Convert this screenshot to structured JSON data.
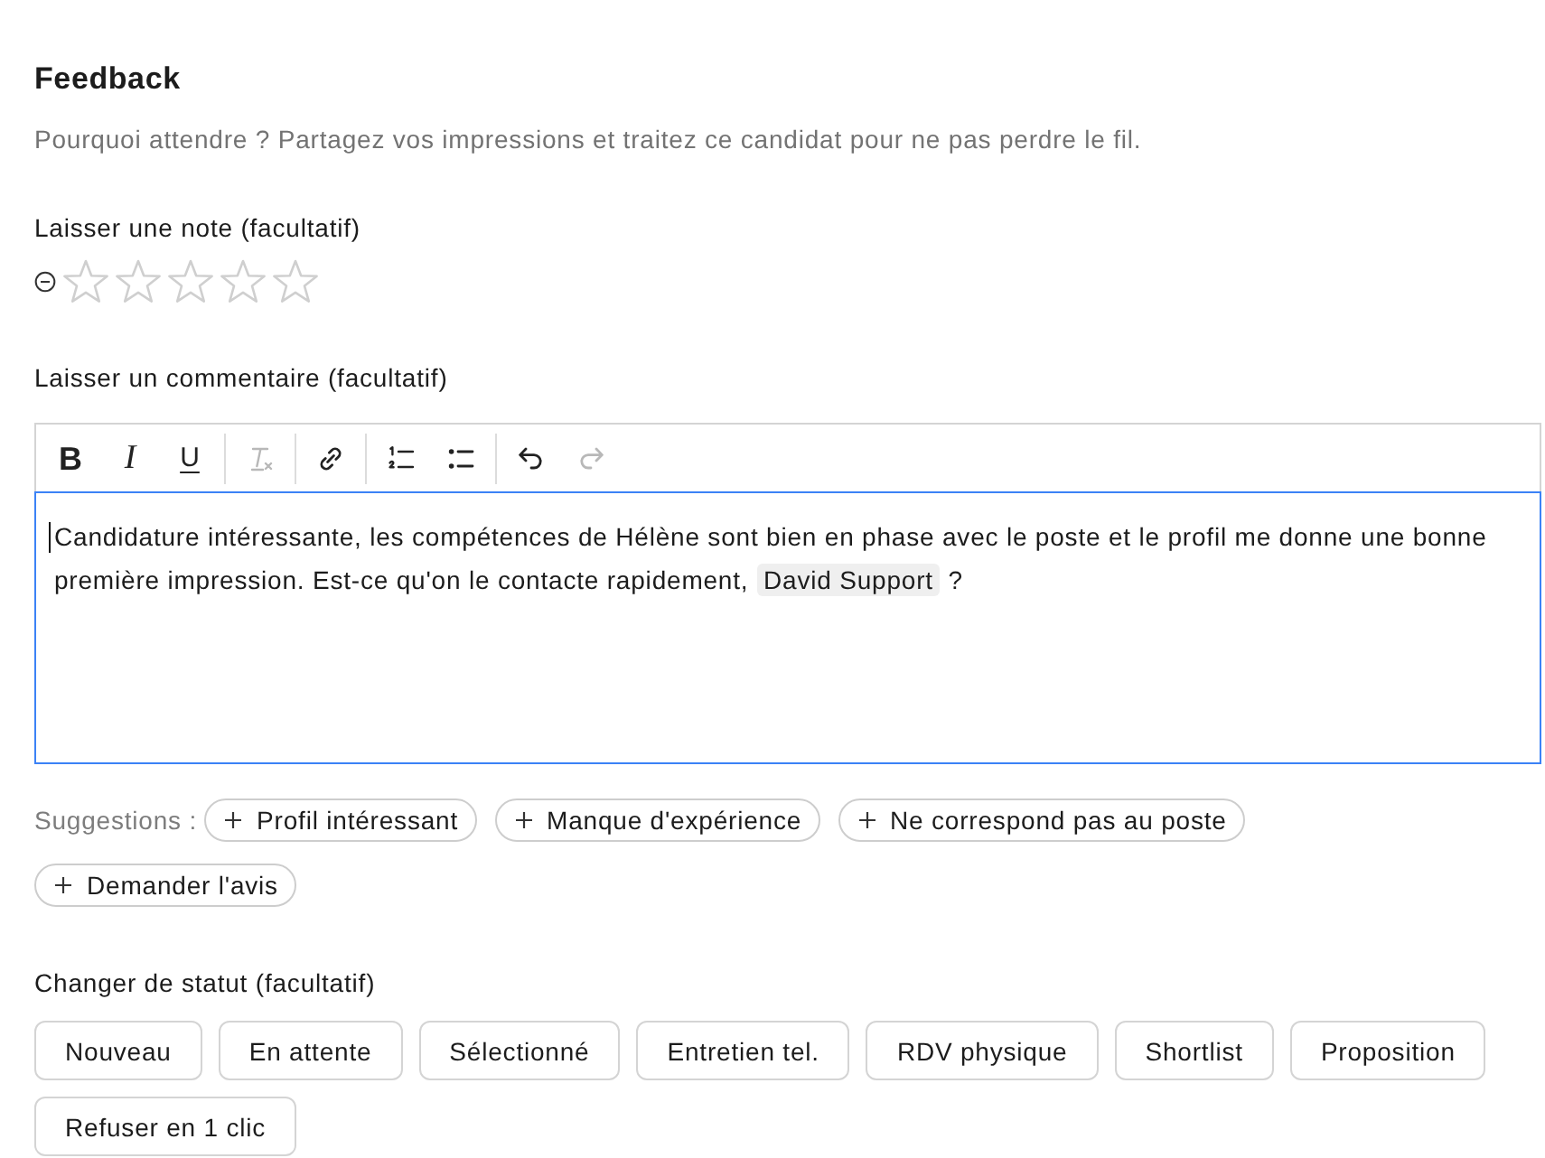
{
  "section": {
    "title": "Feedback",
    "subtitle": "Pourquoi attendre ? Partagez vos impressions et traitez ce candidat pour ne pas perdre le fil."
  },
  "rating": {
    "label": "Laisser une note (facultatif)",
    "stars": 0
  },
  "comment": {
    "label": "Laisser un commentaire (facultatif)",
    "toolbar": [
      {
        "items": [
          {
            "kind": "bold",
            "text": "B",
            "disabled": false
          },
          {
            "kind": "italic",
            "text": "I",
            "disabled": false
          },
          {
            "kind": "underline",
            "text": "U",
            "disabled": false
          }
        ]
      },
      {
        "items": [
          {
            "kind": "clear_format",
            "disabled": true
          }
        ]
      },
      {
        "items": [
          {
            "kind": "link",
            "disabled": false
          }
        ]
      },
      {
        "items": [
          {
            "kind": "ordered_list",
            "disabled": false
          },
          {
            "kind": "bullet_list",
            "disabled": false
          }
        ]
      },
      {
        "items": [
          {
            "kind": "undo",
            "disabled": false
          },
          {
            "kind": "redo",
            "disabled": true
          }
        ]
      }
    ],
    "focused": true,
    "content": [
      {
        "kind": "text",
        "text": "Candidature intéressante, les compétences de Hélène sont bien en phase avec le poste et le profil me donne une bonne première impression. Est-ce qu'on le contacte rapidement, "
      },
      {
        "kind": "mention",
        "text": "David Support"
      },
      {
        "kind": "text",
        "text": " ?"
      }
    ]
  },
  "suggestions": {
    "label": "Suggestions :",
    "chips": [
      "Profil intéressant",
      "Manque d'expérience",
      "Ne correspond pas au poste",
      "Demander l'avis"
    ]
  },
  "status": {
    "label": "Changer de statut (facultatif)",
    "options": [
      {
        "text": "Nouveau",
        "selected": false
      },
      {
        "text": "En attente",
        "selected": false
      },
      {
        "text": "Sélectionné",
        "selected": false
      },
      {
        "text": "Entretien tel.",
        "selected": false
      },
      {
        "text": "RDV physique",
        "selected": false
      },
      {
        "text": "Shortlist",
        "selected": false
      },
      {
        "text": "Proposition",
        "selected": false
      },
      {
        "text": "Refuser en 1 clic",
        "selected": false
      }
    ]
  }
}
